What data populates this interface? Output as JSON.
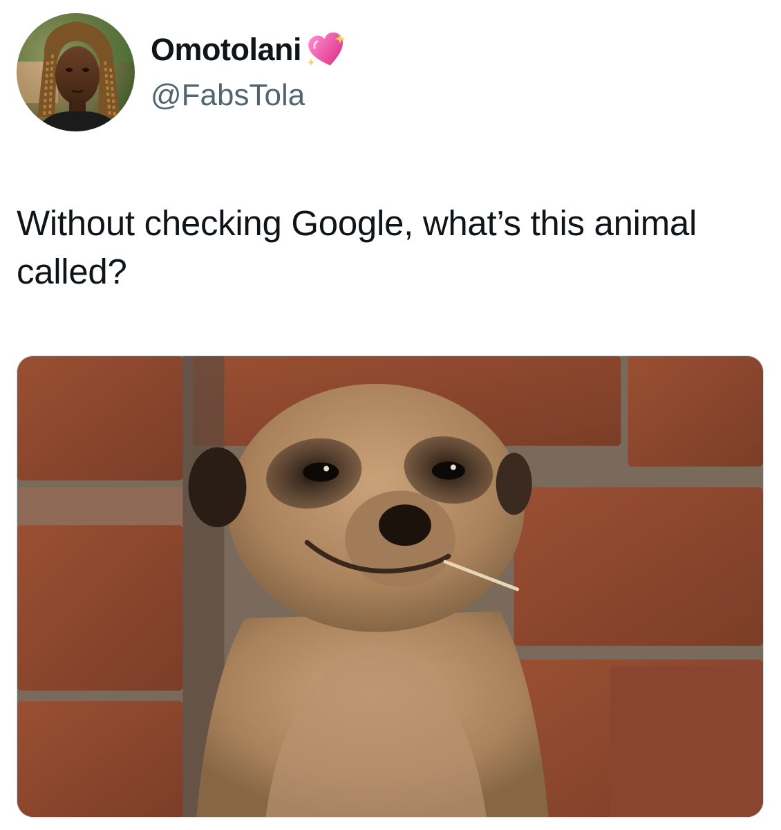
{
  "author": {
    "display_name": "Omotolani",
    "badge_icon": "sparkling-heart-emoji",
    "handle": "@FabsTola",
    "avatar_icon": "profile-photo"
  },
  "tweet": {
    "text": "Without checking Google, what’s this animal called?"
  },
  "media": {
    "subject": "meerkat-photo"
  },
  "colors": {
    "text": "#0f1419",
    "secondary_text": "#536471",
    "border": "#cfd9de",
    "heart_pink": "#e8489b"
  }
}
